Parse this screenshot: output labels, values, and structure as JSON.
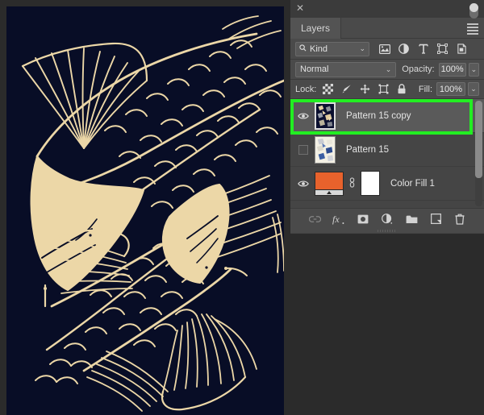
{
  "app": {
    "background_color": "#2b2b2b",
    "panel_bg": "#434343",
    "highlight_color": "#22ee22"
  },
  "canvas": {
    "name": "koi-pattern-artwork",
    "background_color": "#080d26",
    "line_color": "#ecd7a7",
    "description": "Koi fish pattern artwork"
  },
  "panel": {
    "close_label": "✕",
    "collapse_label": "«",
    "menu_label": "panel-menu",
    "tab": "Layers",
    "grip": "panel-grip"
  },
  "filter": {
    "kind_label": "Kind",
    "magnifier": "⚲",
    "chevron": "⌄",
    "icons": [
      {
        "name": "pixel-layer-filter-icon",
        "glyph": "Ὓb"
      },
      {
        "name": "adjustment-layer-filter-icon",
        "glyph": "◑"
      },
      {
        "name": "type-layer-filter-icon",
        "glyph": "T"
      },
      {
        "name": "shape-layer-filter-icon",
        "glyph": "⬚"
      },
      {
        "name": "smart-object-filter-icon",
        "glyph": "⧉"
      }
    ],
    "toggle_name": "filter-enable-toggle"
  },
  "blend": {
    "mode": "Normal",
    "chevron": "⌄",
    "opacity_label": "Opacity:",
    "opacity_value": "100%"
  },
  "lock": {
    "label": "Lock:",
    "icons": [
      {
        "name": "lock-transparent-pixels-icon",
        "glyph": "checker"
      },
      {
        "name": "lock-image-pixels-icon",
        "glyph": "brush"
      },
      {
        "name": "lock-position-icon",
        "glyph": "move"
      },
      {
        "name": "lock-artboard-nesting-icon",
        "glyph": "artboard"
      },
      {
        "name": "lock-all-icon",
        "glyph": "padlock"
      }
    ],
    "fill_label": "Fill:",
    "fill_value": "100%"
  },
  "layers": [
    {
      "name": "Pattern 15 copy",
      "visible": true,
      "selected": true,
      "thumb": "dark-pattern",
      "highlighted": true
    },
    {
      "name": "Pattern 15",
      "visible": false,
      "selected": false,
      "thumb": "light-pattern",
      "highlighted": false
    },
    {
      "name": "Color Fill 1",
      "visible": true,
      "selected": false,
      "thumb": "color-fill",
      "fill_color": "#E8622C",
      "mask_color": "#ffffff",
      "link_glyph": "⚭",
      "highlighted": false
    }
  ],
  "bottom_bar": {
    "icons": [
      {
        "name": "link-layers-icon",
        "glyph": "⚭",
        "dim": true
      },
      {
        "name": "layer-style-fx-icon",
        "glyph": "fx"
      },
      {
        "name": "add-layer-mask-icon",
        "glyph": "mask"
      },
      {
        "name": "new-adjustment-layer-icon",
        "glyph": "halfcircle"
      },
      {
        "name": "new-group-icon",
        "glyph": "folder"
      },
      {
        "name": "new-layer-icon",
        "glyph": "newlayer"
      },
      {
        "name": "delete-layer-icon",
        "glyph": "trash"
      }
    ]
  }
}
